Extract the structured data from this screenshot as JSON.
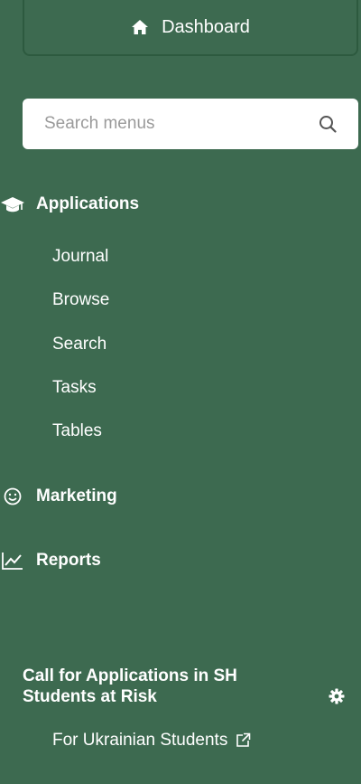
{
  "dashboard": {
    "label": "Dashboard",
    "icon": "home-icon"
  },
  "search": {
    "placeholder": "Search menus",
    "value": "",
    "icon": "search-icon"
  },
  "menu": {
    "applications": {
      "label": "Applications",
      "icon": "graduation-cap-icon",
      "items": [
        "Journal",
        "Browse",
        "Search",
        "Tasks",
        "Tables"
      ]
    },
    "marketing": {
      "label": "Marketing",
      "icon": "smiley-icon"
    },
    "reports": {
      "label": "Reports",
      "icon": "line-chart-icon"
    }
  },
  "call": {
    "title": "Call for Applications in SH Students at Risk",
    "settings_icon": "gear-icon",
    "link_label": "For Ukrainian Students",
    "link_icon": "external-link-icon"
  },
  "colors": {
    "sidebar_bg": "#3d6a50",
    "text": "#ffffff",
    "search_bg": "#ffffff"
  }
}
